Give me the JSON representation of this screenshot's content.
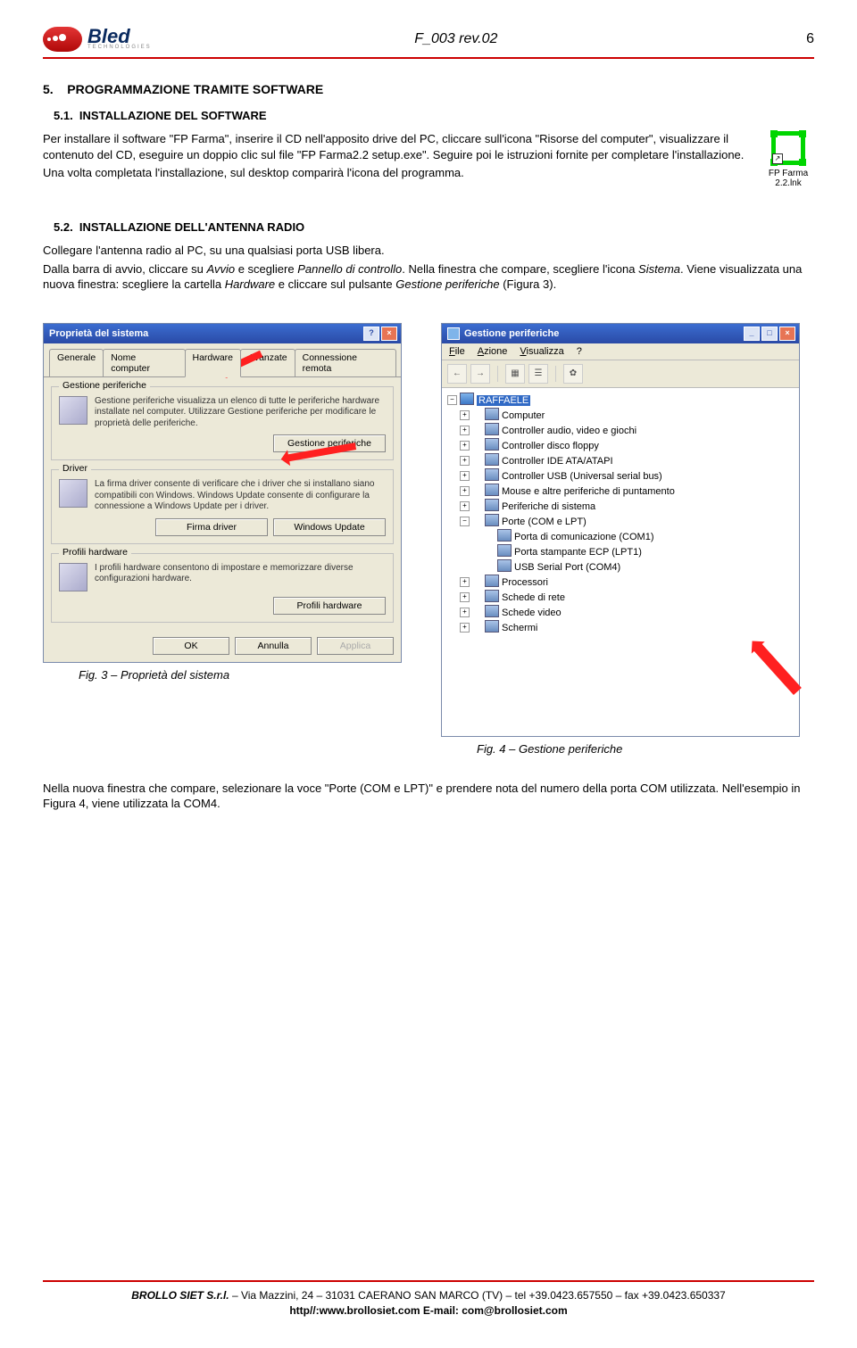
{
  "header": {
    "logo_text": "Bled",
    "logo_sub": "TECHNOLOGIES",
    "doc_title": "F_003 rev.02",
    "page_number": "6"
  },
  "section5": {
    "num": "5.",
    "title": "PROGRAMMAZIONE TRAMITE SOFTWARE"
  },
  "section51": {
    "num": "5.1.",
    "title": "INSTALLAZIONE DEL SOFTWARE",
    "para1": "Per installare il software \"FP Farma\", inserire il CD nell'apposito drive del PC, cliccare sull'icona \"Risorse del computer\", visualizzare il contenuto del CD, eseguire un doppio clic sul file \"FP Farma2.2 setup.exe\". Seguire poi le istruzioni fornite per completare l'installazione.",
    "para2": "Una volta completata l'installazione, sul desktop comparirà l'icona del programma.",
    "icon_caption": "FP Farma 2.2.lnk"
  },
  "section52": {
    "num": "5.2.",
    "title": "INSTALLAZIONE DELL'ANTENNA RADIO",
    "para1": "Collegare l'antenna radio al PC, su una qualsiasi porta USB libera.",
    "para2a": "Dalla barra di avvio, cliccare su ",
    "para2_i1": "Avvio",
    "para2b": " e scegliere ",
    "para2_i2": "Pannello di controllo",
    "para2c": ". Nella finestra che compare, scegliere l'icona ",
    "para2_i3": "Sistema",
    "para2d": ". Viene visualizzata una nuova finestra: scegliere la cartella ",
    "para2_i4": "Hardware",
    "para2e": "  e cliccare sul pulsante ",
    "para2_i5": "Gestione periferiche",
    "para2f": " (Figura 3)."
  },
  "dialog1": {
    "title": "Proprietà del sistema",
    "help": "?",
    "close": "×",
    "tabs": [
      "Generale",
      "Nome computer",
      "Hardware",
      "Avanzate",
      "Connessione remota"
    ],
    "grp1_title": "Gestione periferiche",
    "grp1_text": "Gestione periferiche visualizza un elenco di tutte le periferiche hardware installate nel computer. Utilizzare Gestione periferiche per modificare le proprietà delle periferiche.",
    "btn_gp": "Gestione periferiche",
    "grp2_title": "Driver",
    "grp2_text": "La firma driver consente di verificare che i driver che si installano siano compatibili con Windows. Windows Update consente di configurare la connessione a Windows Update per i driver.",
    "btn_fd": "Firma driver",
    "btn_wu": "Windows Update",
    "grp3_title": "Profili hardware",
    "grp3_text": "I profili hardware consentono di impostare e memorizzare diverse configurazioni hardware.",
    "btn_ph": "Profili hardware",
    "ok": "OK",
    "cancel": "Annulla",
    "apply": "Applica",
    "fig_caption": "Fig. 3 – Proprietà del sistema"
  },
  "dialog2": {
    "title": "Gestione periferiche",
    "menu": [
      "File",
      "Azione",
      "Visualizza",
      "?"
    ],
    "root": "RAFFAELE",
    "items": [
      "Computer",
      "Controller audio, video e giochi",
      "Controller disco floppy",
      "Controller IDE ATA/ATAPI",
      "Controller USB (Universal serial bus)",
      "Mouse e altre periferiche di puntamento",
      "Periferiche di sistema",
      "Porte (COM e LPT)"
    ],
    "ports": [
      "Porta di comunicazione (COM1)",
      "Porta stampante ECP (LPT1)",
      "USB Serial Port (COM4)"
    ],
    "items2": [
      "Processori",
      "Schede di rete",
      "Schede video",
      "Schermi"
    ],
    "fig_caption": "Fig. 4 – Gestione periferiche"
  },
  "closing_para": "Nella nuova finestra che compare, selezionare la voce \"Porte (COM e LPT)\" e prendere nota del numero della porta COM utilizzata. Nell'esempio in Figura 4, viene utilizzata la COM4.",
  "footer": {
    "company": "BROLLO SIET S.r.l.",
    "addr": " – Via Mazzini, 24 – 31031 CAERANO SAN MARCO (TV) – tel +39.0423.657550 – fax +39.0423.650337",
    "web": "http//:www.brollosiet.com  E-mail: com@brollosiet.com"
  }
}
